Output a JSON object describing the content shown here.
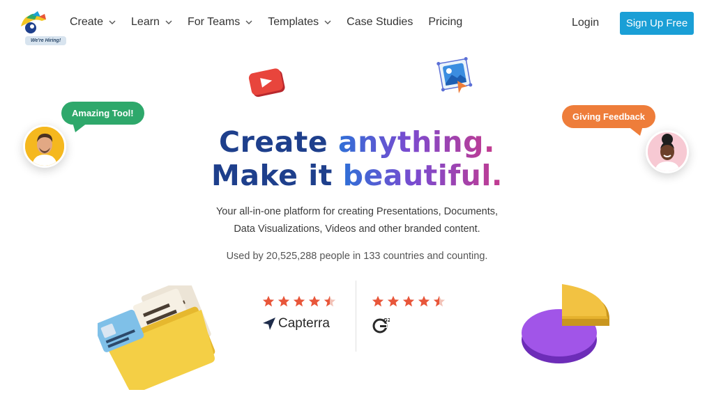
{
  "nav": {
    "hiring_badge": "We're Hiring!",
    "menu": [
      {
        "label": "Create",
        "has_dropdown": true
      },
      {
        "label": "Learn",
        "has_dropdown": true
      },
      {
        "label": "For Teams",
        "has_dropdown": true
      },
      {
        "label": "Templates",
        "has_dropdown": true
      },
      {
        "label": "Case Studies",
        "has_dropdown": false
      },
      {
        "label": "Pricing",
        "has_dropdown": false
      }
    ],
    "login": "Login",
    "signup": "Sign Up Free"
  },
  "hero": {
    "line1_dark": "Create ",
    "line1_grad": "anything.",
    "line2_dark": "Make it ",
    "line2_grad": "beautiful.",
    "subtitle_line1": "Your all-in-one platform for creating Presentations, Documents,",
    "subtitle_line2": "Data Visualizations, Videos and other branded content.",
    "used_by": "Used by 20,525,288 people in 133 countries and counting."
  },
  "bubbles": {
    "left": "Amazing Tool!",
    "right": "Giving Feedback"
  },
  "ratings": [
    {
      "source": "Capterra",
      "stars": 4.5
    },
    {
      "source": "G2",
      "stars": 4.5
    }
  ],
  "colors": {
    "accent": "#1a9fd6",
    "star": "#e8563a",
    "headline_dark": "#1e3f8c",
    "bubble_green": "#2ea86b",
    "bubble_orange": "#ee7d3a"
  }
}
